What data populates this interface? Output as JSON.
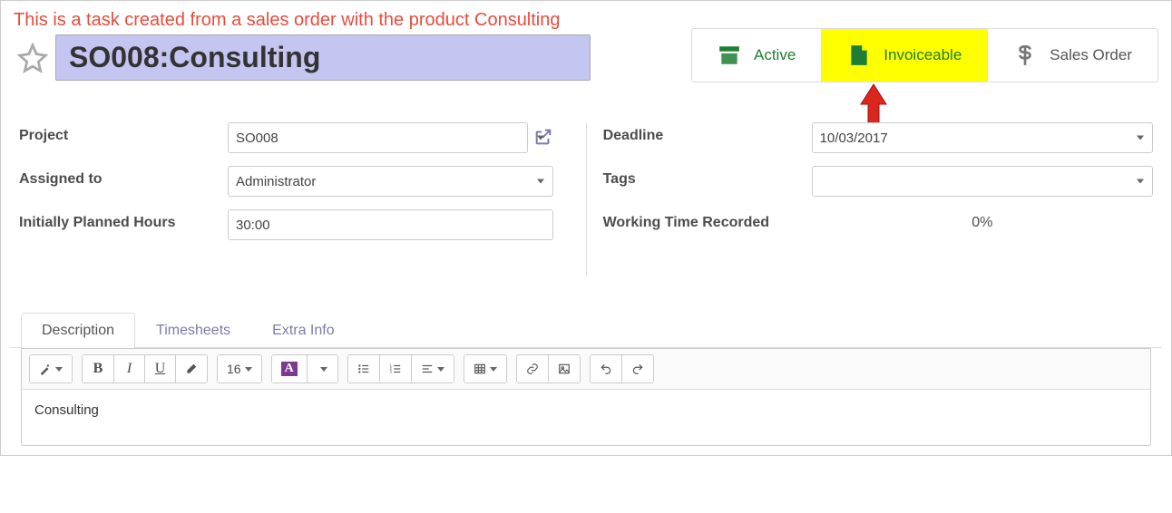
{
  "annotation": "This is a task created from a sales order with the product Consulting",
  "title": "SO008:Consulting",
  "status_buttons": {
    "active": "Active",
    "invoiceable": "Invoiceable",
    "sales_order": "Sales Order"
  },
  "form": {
    "project": {
      "label": "Project",
      "value": "SO008"
    },
    "assigned_to": {
      "label": "Assigned to",
      "value": "Administrator"
    },
    "planned_hours": {
      "label": "Initially Planned Hours",
      "value": "30:00"
    },
    "deadline": {
      "label": "Deadline",
      "value": "10/03/2017"
    },
    "tags": {
      "label": "Tags",
      "value": ""
    },
    "working_time": {
      "label": "Working Time Recorded",
      "value": "0%"
    }
  },
  "tabs": {
    "description": "Description",
    "timesheets": "Timesheets",
    "extra_info": "Extra Info"
  },
  "toolbar": {
    "font_size": "16"
  },
  "editor_content": "Consulting"
}
